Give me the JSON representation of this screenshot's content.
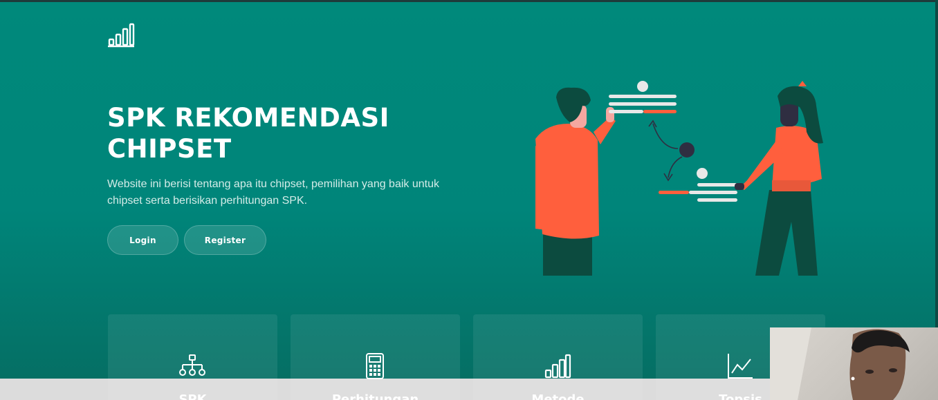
{
  "hero": {
    "title_line1": "SPK REKOMENDASI",
    "title_line2": "CHIPSET",
    "subtitle": "Website ini berisi tentang apa itu chipset, pemilihan yang baik untuk chipset serta berisikan perhitungan SPK."
  },
  "buttons": {
    "login": "Login",
    "register": "Register"
  },
  "cards": [
    {
      "label": "SPK",
      "icon": "sitemap-icon"
    },
    {
      "label": "Perhitungan",
      "icon": "calculator-icon"
    },
    {
      "label": "Metode",
      "icon": "bar-chart-icon"
    },
    {
      "label": "Topsis",
      "icon": "line-chart-icon"
    }
  ],
  "icons": {
    "logo": "bar-chart-logo-icon"
  },
  "colors": {
    "primary": "#00897b",
    "accent": "#ff5f3d",
    "dark_green": "#0c4b3f",
    "navy": "#2f2e41"
  }
}
